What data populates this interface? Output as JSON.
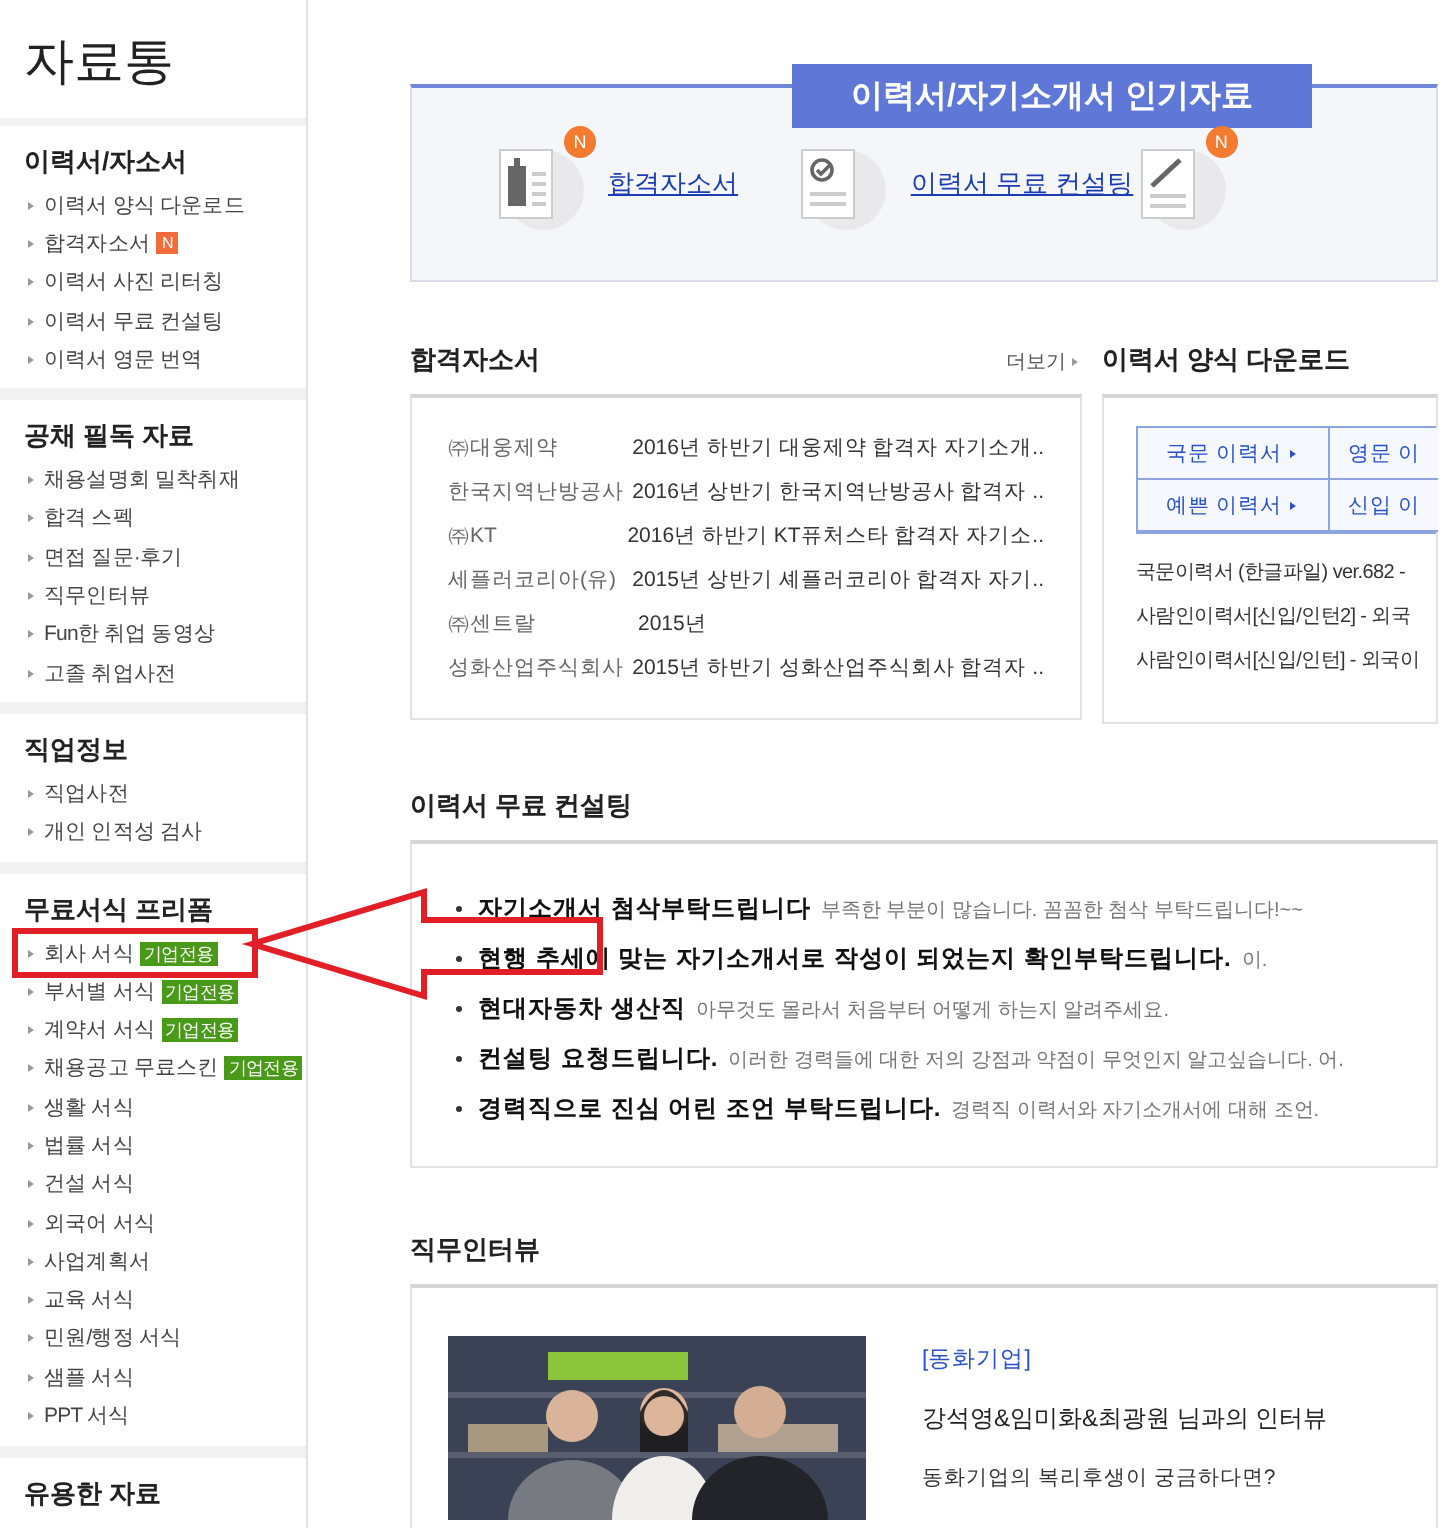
{
  "sidebar": {
    "title": "자료통",
    "sections": [
      {
        "heading": "이력서/자소서",
        "items": [
          {
            "label": "이력서 양식 다운로드"
          },
          {
            "label": "합격자소서",
            "badge": "N"
          },
          {
            "label": "이력서 사진 리터칭"
          },
          {
            "label": "이력서 무료 컨설팅"
          },
          {
            "label": "이력서 영문 번역"
          }
        ]
      },
      {
        "heading": "공채 필독 자료",
        "items": [
          {
            "label": "채용설명회 밀착취재"
          },
          {
            "label": "합격 스펙"
          },
          {
            "label": "면접 질문·후기"
          },
          {
            "label": "직무인터뷰"
          },
          {
            "label": "Fun한 취업 동영상"
          },
          {
            "label": "고졸 취업사전"
          }
        ]
      },
      {
        "heading": "직업정보",
        "items": [
          {
            "label": "직업사전"
          },
          {
            "label": "개인 인적성 검사"
          }
        ]
      },
      {
        "heading": "무료서식 프리폼",
        "items": [
          {
            "label": "회사 서식",
            "tag": "기업전용",
            "highlighted": true
          },
          {
            "label": "부서별 서식",
            "tag": "기업전용"
          },
          {
            "label": "계약서 서식",
            "tag": "기업전용"
          },
          {
            "label": "채용공고 무료스킨",
            "tag": "기업전용"
          },
          {
            "label": "생활 서식"
          },
          {
            "label": "법률 서식"
          },
          {
            "label": "건설 서식"
          },
          {
            "label": "외국어 서식"
          },
          {
            "label": "사업계획서"
          },
          {
            "label": "교육 서식"
          },
          {
            "label": "민원/행정 서식"
          },
          {
            "label": "샘플 서식"
          },
          {
            "label": "PPT 서식"
          }
        ]
      },
      {
        "heading": "유용한 자료"
      }
    ]
  },
  "banner": {
    "title": "이력서/자기소개서 인기자료",
    "items": [
      {
        "kind": "building",
        "label": "합격자소서",
        "badge": "N"
      },
      {
        "kind": "check",
        "label": "이력서 무료 컨설팅"
      },
      {
        "kind": "brush",
        "badge": "N"
      }
    ]
  },
  "passed_letters": {
    "title": "합격자소서",
    "more": "더보기",
    "rows": [
      {
        "company": "㈜대웅제약",
        "title": "2016년 하반기 대웅제약 합격자 자기소개.."
      },
      {
        "company": "한국지역난방공사",
        "title": "2016년 상반기 한국지역난방공사 합격자 .."
      },
      {
        "company": "㈜KT",
        "title": "2016년 하반기 KT퓨처스타 합격자 자기소.."
      },
      {
        "company": "세플러코리아(유)",
        "title": "2015년 상반기 셰플러코리아 합격자 자기.."
      },
      {
        "company": "㈜센트랄",
        "title": "2015년"
      },
      {
        "company": "성화산업주식회사",
        "title": "2015년 하반기 성화산업주식회사 합격자 .."
      }
    ]
  },
  "resume_download": {
    "title": "이력서 양식 다운로드",
    "buttons": [
      "국문 이력서",
      "영문 이",
      "예쁜 이력서",
      "신입 이"
    ],
    "files": [
      "국문이력서 (한글파일) ver.682 -",
      "사람인이력서[신입/인턴2] - 외국",
      "사람인이력서[신입/인턴] - 외국이"
    ]
  },
  "consulting": {
    "title": "이력서 무료 컨설팅",
    "items": [
      {
        "title": "자기소개서 첨삭부탁드립니다",
        "text": "부족한 부분이 많습니다. 꼼꼼한 첨삭 부탁드립니다!~~"
      },
      {
        "title": "현행 추세에 맞는 자기소개서로 작성이 되었는지 확인부탁드립니다.",
        "text": "이."
      },
      {
        "title": "현대자동차 생산직",
        "text": "아무것도 몰라서 처음부터 어떻게 하는지 알려주세요."
      },
      {
        "title": "컨설팅 요청드립니다.",
        "text": "이러한 경력들에 대한 저의 강점과 약점이 무엇인지 알고싶습니다. 어."
      },
      {
        "title": "경력직으로 진심 어린 조언 부탁드립니다.",
        "text": "경력직 이력서와 자기소개서에 대해 조언."
      }
    ]
  },
  "interview": {
    "title": "직무인터뷰",
    "company": "[동화기업]",
    "headline": "강석영&임미화&최광원 님과의 인터뷰",
    "summary": "동화기업의 복리후생이 궁금하다면?"
  }
}
